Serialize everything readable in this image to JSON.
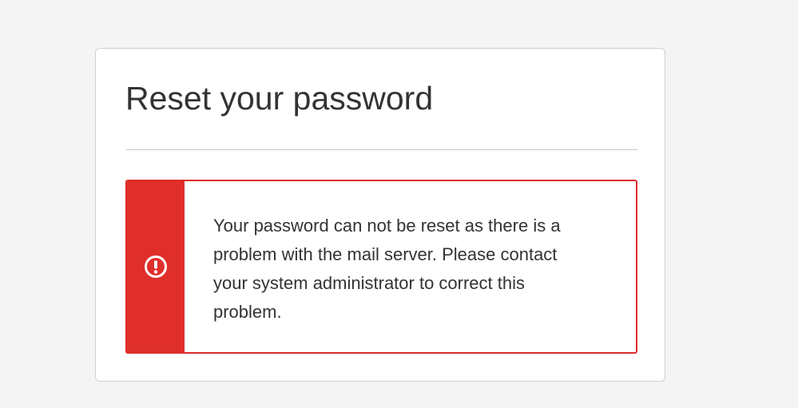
{
  "dialog": {
    "title": "Reset your password"
  },
  "alert": {
    "icon": "exclamation-circle-icon",
    "message": "Your password can not be reset as there is a problem with the mail server. Please contact your system administrator to correct this problem.",
    "accent_color": "#e02f2a"
  }
}
